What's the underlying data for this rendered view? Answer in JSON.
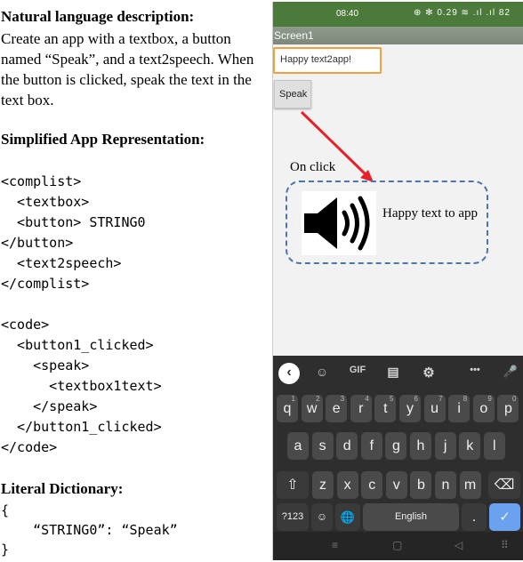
{
  "left": {
    "heading_nl": "Natural language description:",
    "nl_text": "Create an app with a textbox, a button named “Speak”, and a text2speech. When the button is clicked, speak the text in the text box.",
    "heading_sar": "Simplified App Representation:",
    "complist": [
      "<complist>",
      "  <textbox>",
      "  <button> STRING0",
      "</button>",
      "  <text2speech>",
      "</complist>"
    ],
    "code": [
      "<code>",
      "  <button1_clicked>",
      "    <speak>",
      "      <textbox1text>",
      "    </speak>",
      "  </button1_clicked>",
      "</code>"
    ],
    "heading_dict": "Literal Dictionary:",
    "dict": [
      "{",
      "    “STRING0”: “Speak”",
      "}"
    ]
  },
  "phone": {
    "time": "08:40",
    "status_icons": "⊕ ✻ 0.29 ≋ .ıl .ıl 82",
    "screen_title": "Screen1",
    "textbox_value": "Happy text2app!",
    "button_label": "Speak",
    "annotation": "On click",
    "spoken_text": "Happy text to app",
    "accent_color": "#e8202a",
    "dash_color": "#4a74b5"
  },
  "keyboard": {
    "toolbar": [
      "‹",
      "☺",
      "GIF",
      "▤",
      "⚙",
      "•••",
      "🎤"
    ],
    "row1": [
      {
        "k": "q",
        "n": "1"
      },
      {
        "k": "w",
        "n": "2"
      },
      {
        "k": "e",
        "n": "3"
      },
      {
        "k": "r",
        "n": "4"
      },
      {
        "k": "t",
        "n": "5"
      },
      {
        "k": "y",
        "n": "6"
      },
      {
        "k": "u",
        "n": "7"
      },
      {
        "k": "i",
        "n": "8"
      },
      {
        "k": "o",
        "n": "9"
      },
      {
        "k": "p",
        "n": "0"
      }
    ],
    "row2": [
      "a",
      "s",
      "d",
      "f",
      "g",
      "h",
      "j",
      "k",
      "l"
    ],
    "row3": [
      "z",
      "x",
      "c",
      "v",
      "b",
      "n",
      "m"
    ],
    "shift": "⇧",
    "backspace": "⌫",
    "sym": "?123",
    "emoji": "☺",
    "globe": "🌐",
    "space": "English",
    "period": ".",
    "enter": "✓"
  },
  "navbar": [
    "≡",
    "▢",
    "◁",
    "⠿"
  ]
}
